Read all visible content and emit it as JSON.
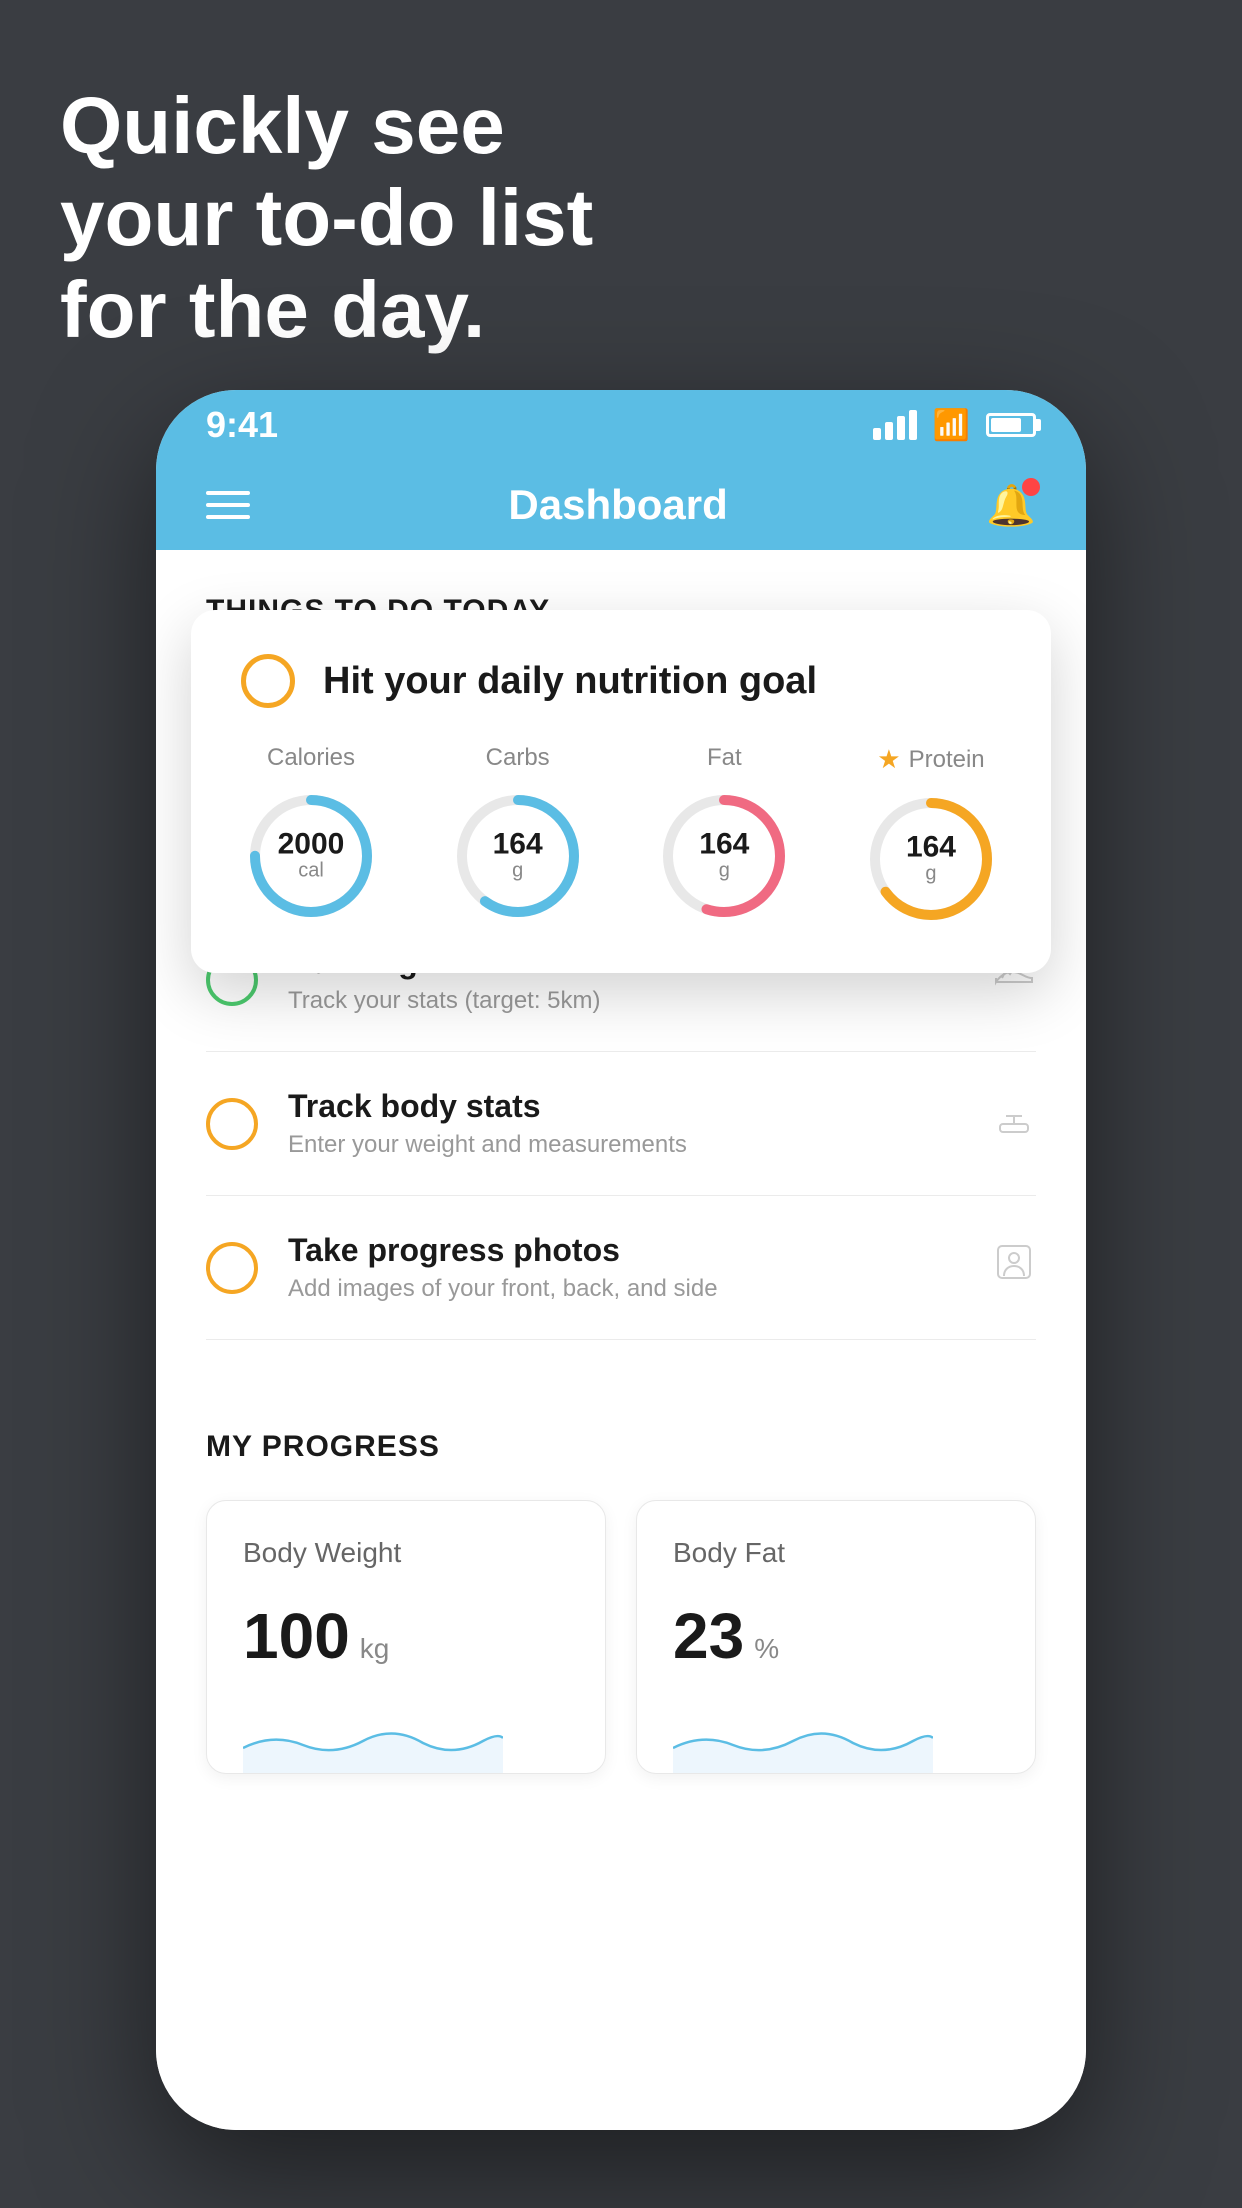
{
  "headline": {
    "line1": "Quickly see",
    "line2": "your to-do list",
    "line3": "for the day."
  },
  "status_bar": {
    "time": "9:41"
  },
  "nav": {
    "title": "Dashboard"
  },
  "things_section": {
    "header": "THINGS TO DO TODAY"
  },
  "floating_card": {
    "title": "Hit your daily nutrition goal",
    "nutrition": [
      {
        "label": "Calories",
        "value": "2000",
        "unit": "cal",
        "color": "#5bbde4",
        "track": 75,
        "starred": false
      },
      {
        "label": "Carbs",
        "value": "164",
        "unit": "g",
        "color": "#5bbde4",
        "track": 60,
        "starred": false
      },
      {
        "label": "Fat",
        "value": "164",
        "unit": "g",
        "color": "#f06a82",
        "track": 55,
        "starred": false
      },
      {
        "label": "Protein",
        "value": "164",
        "unit": "g",
        "color": "#f5a623",
        "track": 65,
        "starred": true
      }
    ]
  },
  "todo_items": [
    {
      "type": "green",
      "title": "Running",
      "subtitle": "Track your stats (target: 5km)",
      "icon": "shoe"
    },
    {
      "type": "yellow",
      "title": "Track body stats",
      "subtitle": "Enter your weight and measurements",
      "icon": "scale"
    },
    {
      "type": "yellow",
      "title": "Take progress photos",
      "subtitle": "Add images of your front, back, and side",
      "icon": "person"
    }
  ],
  "progress_section": {
    "header": "MY PROGRESS",
    "cards": [
      {
        "title": "Body Weight",
        "value": "100",
        "unit": "kg"
      },
      {
        "title": "Body Fat",
        "value": "23",
        "unit": "%"
      }
    ]
  }
}
